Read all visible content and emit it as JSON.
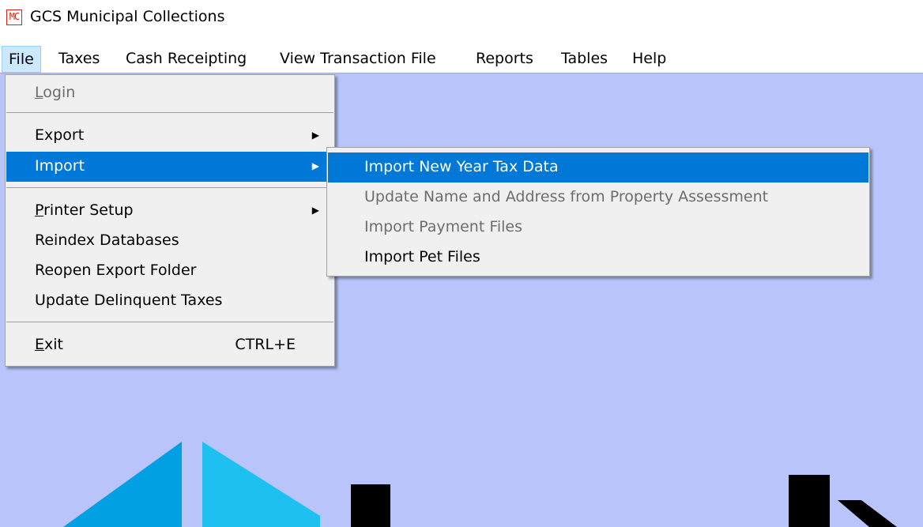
{
  "window": {
    "title": "GCS Municipal Collections",
    "icon": "MC"
  },
  "menubar": [
    {
      "label": "File"
    },
    {
      "label": "Taxes"
    },
    {
      "label": "Cash Receipting"
    },
    {
      "label": "View Transaction File"
    },
    {
      "label": "Reports"
    },
    {
      "label": "Tables"
    },
    {
      "label": "Help"
    }
  ],
  "file_menu": {
    "items": [
      {
        "label": "Login",
        "mnemonic": "L",
        "disabled": true
      },
      {
        "label": "Export",
        "submenu": true
      },
      {
        "label": "Import",
        "submenu": true,
        "highlighted": true
      },
      {
        "label": "Printer Setup",
        "mnemonic": "P",
        "submenu": true
      },
      {
        "label": "Reindex Databases"
      },
      {
        "label": "Reopen Export Folder"
      },
      {
        "label": "Update Delinquent Taxes"
      },
      {
        "label": "Exit",
        "mnemonic": "E",
        "shortcut": "CTRL+E"
      }
    ]
  },
  "import_submenu": {
    "items": [
      {
        "label": "Import New Year Tax Data",
        "highlighted": true
      },
      {
        "label": "Update Name and Address from Property Assessment",
        "disabled": true
      },
      {
        "label": "Import Payment Files",
        "disabled": true
      },
      {
        "label": "Import Pet Files"
      }
    ]
  },
  "colors": {
    "accent": "#0078d7",
    "client_background": "#b8c4fa",
    "menu_background": "#f0f0f0",
    "disabled_text": "#6d6d6d",
    "logo_blue_dark": "#00a0e3",
    "logo_blue_light": "#1ec0ef"
  }
}
